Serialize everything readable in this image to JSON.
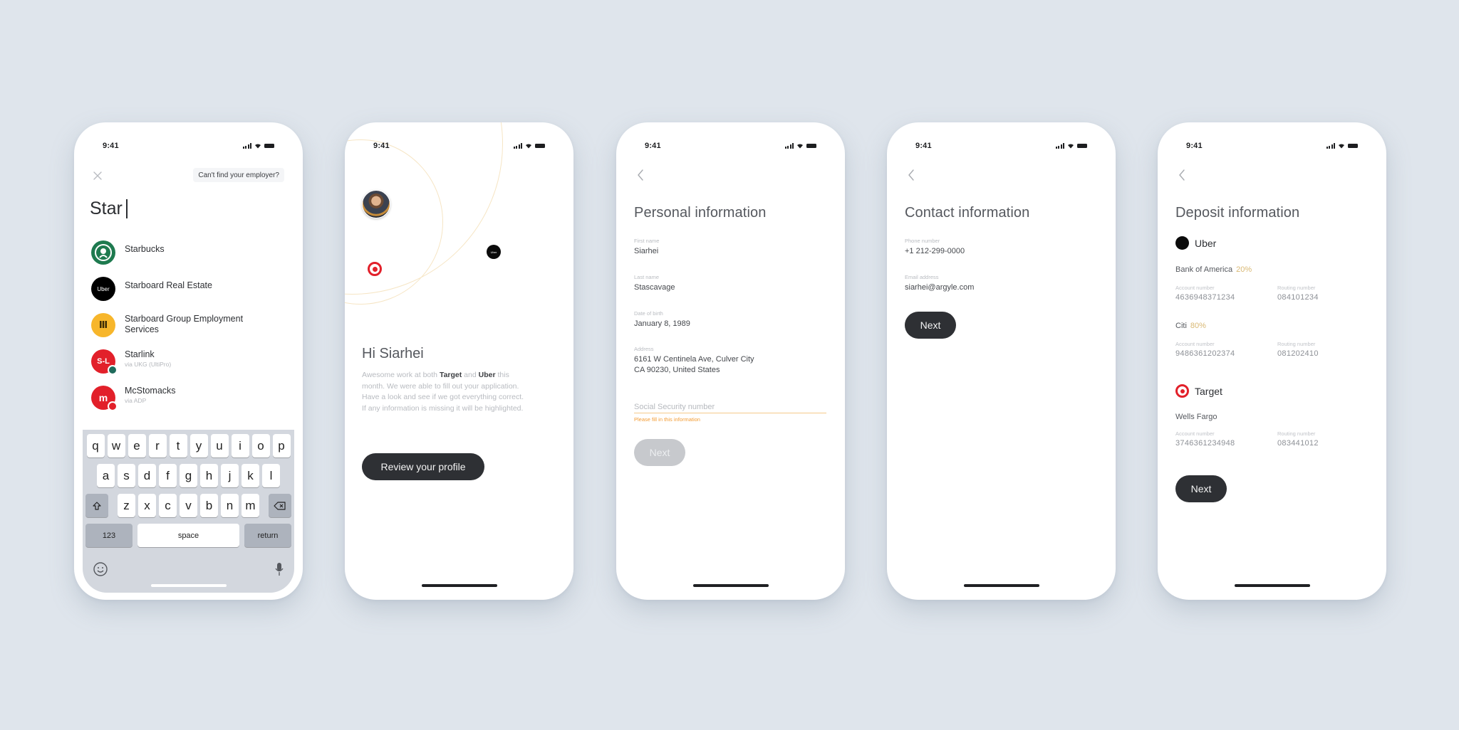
{
  "status_bar": {
    "time": "9:41"
  },
  "screens": {
    "employer_search": {
      "cant_find_label": "Can't find your employer?",
      "search_value": "Star",
      "results": [
        {
          "name": "Starbucks",
          "sub": "",
          "logo": "starbucks-logo",
          "logo_text": "",
          "color": "#1e7a4f"
        },
        {
          "name": "Starboard Real Estate",
          "sub": "",
          "logo": "uber-logo",
          "logo_text": "Uber",
          "color": "#000000"
        },
        {
          "name": "Starboard Group Employment Services",
          "sub": "",
          "logo": "starboard-group-logo",
          "logo_text": "Ⅲ",
          "color": "#f7b62b"
        },
        {
          "name": "Starlink",
          "sub": "via UKG (UltiPro)",
          "logo": "starlink-logo",
          "logo_text": "S-L",
          "color": "#e2202a",
          "badge_color": "#1f6b5b"
        },
        {
          "name": "McStomacks",
          "sub": "via ADP",
          "logo": "mcstomacks-logo",
          "logo_text": "m",
          "color": "#e2202a",
          "badge_color": "#e2202a"
        }
      ],
      "keyboard": {
        "row1": [
          "q",
          "w",
          "e",
          "r",
          "t",
          "y",
          "u",
          "i",
          "o",
          "p"
        ],
        "row2": [
          "a",
          "s",
          "d",
          "f",
          "g",
          "h",
          "j",
          "k",
          "l"
        ],
        "row3": [
          "z",
          "x",
          "c",
          "v",
          "b",
          "n",
          "m"
        ],
        "numbers_label": "123",
        "space_label": "space",
        "return_label": "return"
      }
    },
    "welcome": {
      "greeting": "Hi Siarhei",
      "intro_prefix": "Awesome work at both ",
      "employer_a": "Target",
      "intro_and": " and ",
      "employer_b": "Uber",
      "intro_suffix": " this month. We were able to fill out your application. Have a look and see if we got everything correct. If any information is missing it will be highlighted.",
      "review_button": "Review your profile",
      "uber_node_text": "Uber"
    },
    "personal_info": {
      "title": "Personal information",
      "fields": [
        {
          "label": "First name",
          "value": "Siarhei"
        },
        {
          "label": "Last name",
          "value": "Stascavage"
        },
        {
          "label": "Date of birth",
          "value": "January 8, 1989"
        },
        {
          "label": "Address",
          "value_line1": "6161 W Centinela Ave, Culver City",
          "value_line2": "CA 90230, United States"
        }
      ],
      "ssn_placeholder": "Social Security number",
      "ssn_error": "Please fill in this information",
      "next_button": "Next",
      "error_color": "#f39c34"
    },
    "contact_info": {
      "title": "Contact information",
      "fields": [
        {
          "label": "Phone number",
          "value": "+1 212-299-0000"
        },
        {
          "label": "Email address",
          "value": "siarhei@argyle.com"
        }
      ],
      "next_button": "Next"
    },
    "deposit_info": {
      "title": "Deposit information",
      "employers": [
        {
          "name": "Uber",
          "accounts": [
            {
              "bank": "Bank of America",
              "percent": "20%",
              "account_label": "Account number",
              "account": "4636948371234",
              "routing_label": "Routing number",
              "routing": "084101234"
            },
            {
              "bank": "Citi",
              "percent": "80%",
              "account_label": "Account number",
              "account": "9486361202374",
              "routing_label": "Routing number",
              "routing": "081202410"
            }
          ]
        },
        {
          "name": "Target",
          "accounts": [
            {
              "bank": "Wells Fargo",
              "percent": "",
              "account_label": "Account number",
              "account": "3746361234948",
              "routing_label": "Routing number",
              "routing": "083441012"
            }
          ]
        }
      ],
      "next_button": "Next",
      "percent_color": "#d9b873"
    }
  }
}
